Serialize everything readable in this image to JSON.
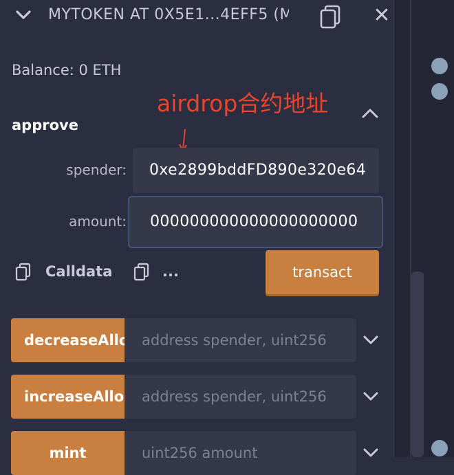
{
  "header": {
    "title": "MYTOKEN AT 0X5E1...4EFF5 (M",
    "collapse_icon": "chevron-down-icon",
    "copy_icon": "copy-icon",
    "close_label": "✕"
  },
  "balance": "Balance: 0 ETH",
  "annotation": "airdrop合约地址",
  "approve": {
    "name": "approve",
    "fields": [
      {
        "label": "spender:",
        "value": "0xe2899bddFD890e320e64"
      },
      {
        "label": "amount:",
        "value": "000000000000000000000"
      }
    ],
    "calldata_label": "Calldata",
    "more_label": "...",
    "transact_label": "transact"
  },
  "functions": [
    {
      "name": "decreaseAllowance",
      "placeholder": "address spender, uint256"
    },
    {
      "name": "increaseAllowance",
      "placeholder": "address spender, uint256"
    },
    {
      "name": "mint",
      "placeholder": "uint256 amount"
    }
  ],
  "colors": {
    "background": "#2b2e40",
    "accent_button": "#c97f3f",
    "input_bg": "#353849",
    "annotation": "#e8452e"
  }
}
